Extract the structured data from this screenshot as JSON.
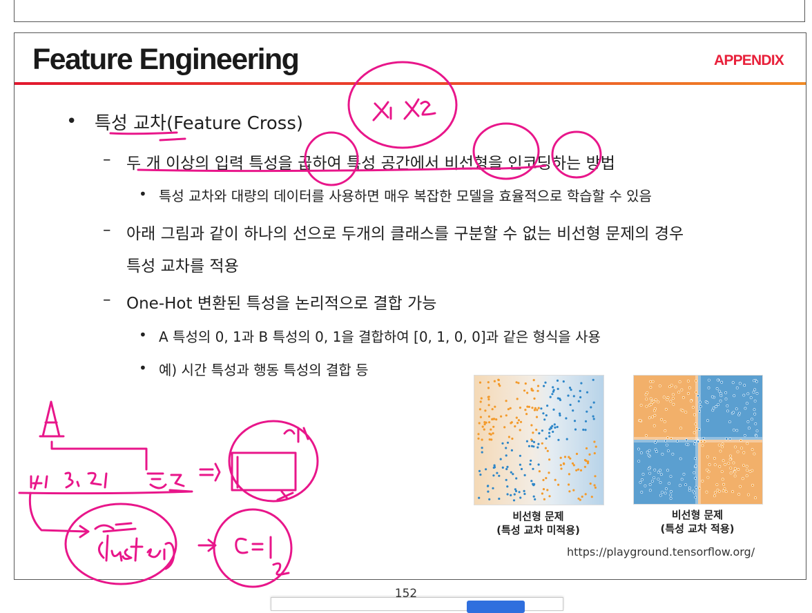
{
  "slide": {
    "title": "Feature Engineering",
    "tag": "APPENDIX",
    "bullets": {
      "b1": "특성 교차(Feature Cross)",
      "b1_1": "두 개 이상의 입력 특성을 곱하여 특성 공간에서 비선형을 인코딩하는 방법",
      "b1_1_1": "특성 교차와 대량의 데이터를 사용하면 매우 복잡한 모델을 효율적으로 학습할 수 있음",
      "b1_2_line1": "아래 그림과 같이 하나의 선으로 두개의 클래스를 구분할 수 없는 비선형 문제의 경우",
      "b1_2_line2": "특성 교차를 적용",
      "b1_3": "One-Hot 변환된 특성을 논리적으로 결합 가능",
      "b1_3_1": "A 특성의 0, 1과 B 특성의 0, 1을 결합하여 [0, 1, 0, 0]과 같은 형식을 사용",
      "b1_3_2": "예) 시간 특성과 행동 특성의 결합 등"
    },
    "bullet_symbols": {
      "dot": "•",
      "dash": "–"
    },
    "figures": {
      "left_caption_1": "비선형 문제",
      "left_caption_2": "(특성 교차 미적용)",
      "right_caption_1": "비선형 문제",
      "right_caption_2": "(특성 교차 적용)",
      "source_url": "https://playground.tensorflow.org/"
    },
    "colors": {
      "title_bar_start": "#e2182f",
      "title_bar_end": "#f08a25",
      "appendix": "#e8203a",
      "orange_points": "#f39a2b",
      "blue_points": "#2e86c8",
      "ink": "#e8168a"
    }
  },
  "page_number": "152"
}
